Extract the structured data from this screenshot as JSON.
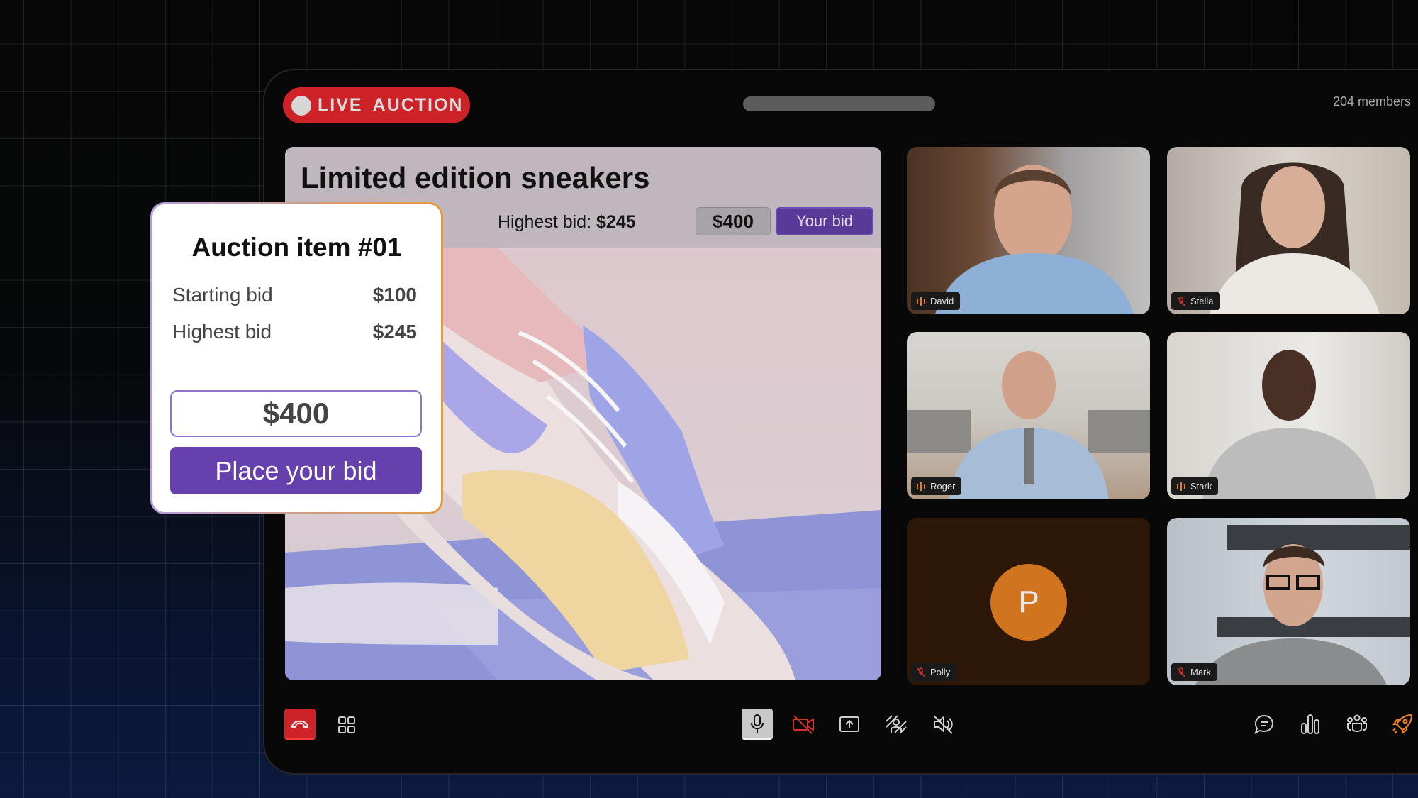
{
  "header": {
    "live_badge": "LIVE  AUCTION",
    "members": "204 members"
  },
  "main": {
    "title": "Limited edition sneakers",
    "highest_bid_label": "Highest bid:",
    "highest_bid_value": "$245",
    "bid_amount": "$400",
    "your_bid_button": "Your bid"
  },
  "card": {
    "title": "Auction item #01",
    "rows": [
      {
        "label": "Starting bid",
        "value": "$100"
      },
      {
        "label": "Highest bid",
        "value": "$245"
      }
    ],
    "bid_input_value": "$400",
    "place_bid_button": "Place your bid"
  },
  "participants": [
    {
      "name": "David",
      "status": "speaking"
    },
    {
      "name": "Stella",
      "status": "muted"
    },
    {
      "name": "Roger",
      "status": "speaking"
    },
    {
      "name": "Stark",
      "status": "speaking"
    },
    {
      "name": "Polly",
      "status": "muted",
      "initial": "P"
    },
    {
      "name": "Mark",
      "status": "muted"
    }
  ],
  "toolbar": {
    "left": [
      "end-call-icon",
      "grid-view-icon"
    ],
    "center": [
      "microphone-icon",
      "camera-off-icon",
      "screen-share-icon",
      "background-blur-icon",
      "speaker-muted-icon"
    ],
    "right": [
      "chat-icon",
      "poll-icon",
      "participants-icon",
      "boost-icon"
    ]
  },
  "colors": {
    "live_red": "#cd2328",
    "accent_purple": "#6641ad",
    "speaking_orange": "#e67e22",
    "muted_red": "#d0362c",
    "avatar_orange": "#d1741e"
  }
}
